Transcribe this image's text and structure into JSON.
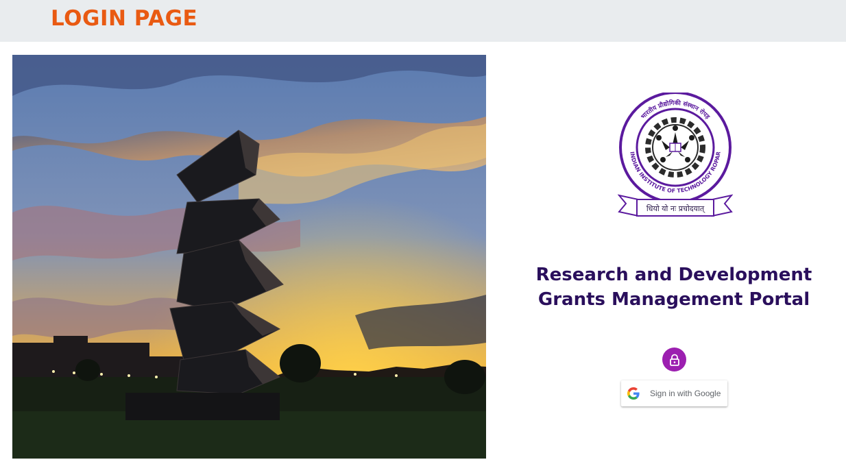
{
  "header": {
    "title": "LOGIN PAGE"
  },
  "hero_image": {
    "alt": "Campus sculpture at sunset"
  },
  "logo": {
    "alt": "Indian Institute of Technology Ropar emblem",
    "text_hindi_top": "भारतीय प्रौद्योगिकी संस्थान रोपड़",
    "text_english": "INDIAN INSTITUTE OF TECHNOLOGY ROPAR",
    "motto": "धियो यो नः प्रचोदयात्"
  },
  "portal": {
    "title_line1": "Research and Development",
    "title_line2": "Grants Management Portal"
  },
  "auth": {
    "lock_icon": "lock-icon",
    "google_button_label": "Sign in with Google",
    "google_icon": "google-g-icon"
  },
  "colors": {
    "header_bg": "#e9ecee",
    "header_text": "#e95a12",
    "title_text": "#2a0f5c",
    "lock_bg": "#9c1fb0",
    "logo_purple": "#5b1a9e"
  }
}
